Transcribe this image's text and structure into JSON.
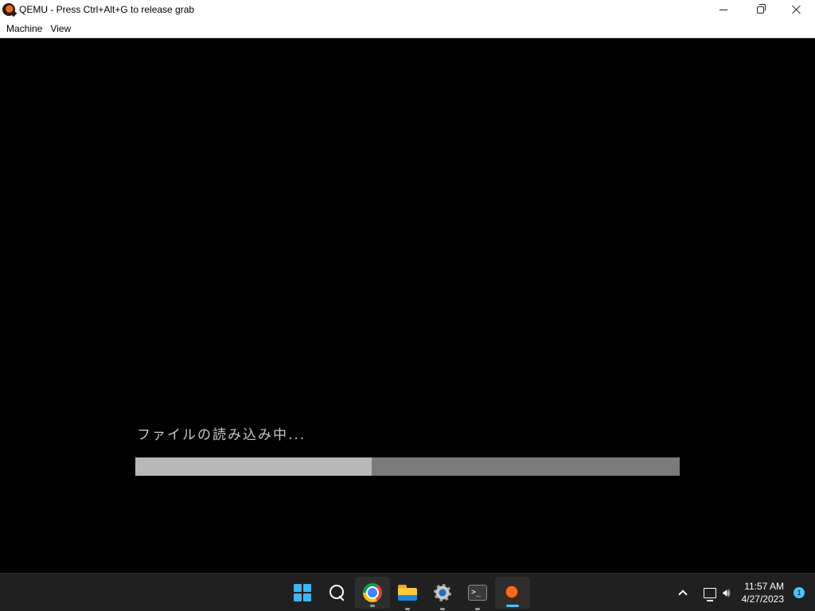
{
  "window": {
    "title": "QEMU - Press Ctrl+Alt+G to release grab",
    "icon": "qemu-icon"
  },
  "menu": {
    "items": [
      "Machine",
      "View"
    ]
  },
  "guest": {
    "loading_text": "ファイルの読み込み中...",
    "progress_fraction": 0.434,
    "colors": {
      "fill": "#b8b8b8",
      "track": "#7a7a7a",
      "text": "#c8c8c8"
    }
  },
  "taskbar": {
    "apps": [
      {
        "name": "start-icon",
        "active": false,
        "running": false
      },
      {
        "name": "search-icon",
        "active": false,
        "running": false
      },
      {
        "name": "chrome-icon",
        "active": true,
        "running": true
      },
      {
        "name": "file-explorer-icon",
        "active": false,
        "running": true
      },
      {
        "name": "settings-icon",
        "active": false,
        "running": true
      },
      {
        "name": "terminal-icon",
        "active": false,
        "running": true
      },
      {
        "name": "qemu-icon",
        "active": true,
        "running": true
      }
    ],
    "tray": {
      "time": "11:57 AM",
      "date": "4/27/2023",
      "notification_count": "1"
    }
  }
}
